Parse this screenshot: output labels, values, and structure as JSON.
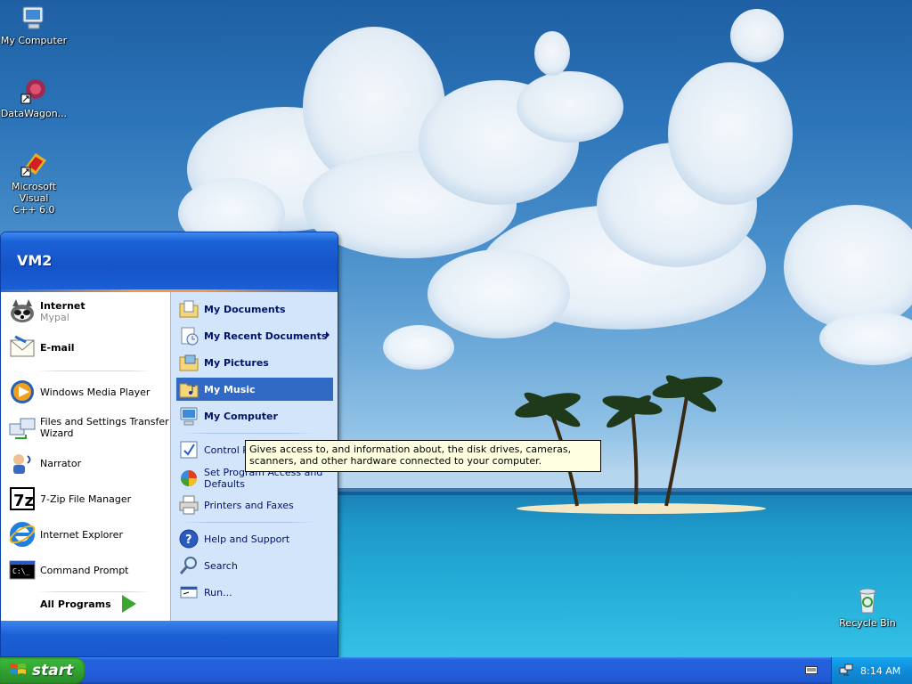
{
  "desktop": {
    "icons": [
      {
        "label": "My Computer",
        "icon": "my-computer-icon"
      },
      {
        "label": "DataWagon...",
        "icon": "datawagon-shortcut-icon"
      },
      {
        "label": "Microsoft Visual\nC++ 6.0",
        "icon": "visual-cpp-shortcut-icon"
      },
      {
        "label": "Recycle Bin",
        "icon": "recycle-bin-icon"
      }
    ]
  },
  "start_menu": {
    "user_name": "VM2",
    "pinned": [
      {
        "label": "Internet",
        "sub": "Mypal",
        "icon": "mypal-browser-icon"
      },
      {
        "label": "E-mail",
        "icon": "email-icon"
      }
    ],
    "recent": [
      {
        "label": "Windows Media Player",
        "icon": "windows-media-player-icon"
      },
      {
        "label": "Files and Settings Transfer\nWizard",
        "icon": "files-settings-transfer-icon"
      },
      {
        "label": "Narrator",
        "icon": "narrator-icon"
      },
      {
        "label": "7-Zip File Manager",
        "icon": "seven-zip-icon"
      },
      {
        "label": "Internet Explorer",
        "icon": "internet-explorer-icon"
      },
      {
        "label": "Command Prompt",
        "icon": "command-prompt-icon"
      }
    ],
    "all_programs": "All Programs",
    "places": [
      {
        "label": "My Documents",
        "icon": "my-documents-icon"
      },
      {
        "label": "My Recent Documents",
        "icon": "my-recent-documents-icon"
      },
      {
        "label": "My Pictures",
        "icon": "my-pictures-icon"
      },
      {
        "label": "My Music",
        "icon": "my-music-icon",
        "selected": true
      },
      {
        "label": "My Computer",
        "icon": "my-computer-icon"
      }
    ],
    "settings": [
      {
        "label": "Control Panel",
        "icon": "control-panel-icon"
      },
      {
        "label": "Set Program Access and\nDefaults",
        "icon": "set-program-access-icon"
      },
      {
        "label": "Printers and Faxes",
        "icon": "printers-faxes-icon"
      }
    ],
    "help": [
      {
        "label": "Help and Support",
        "icon": "help-icon"
      },
      {
        "label": "Search",
        "icon": "search-icon"
      },
      {
        "label": "Run...",
        "icon": "run-icon"
      }
    ]
  },
  "tooltip": "Gives access to, and information about, the disk drives, cameras, scanners, and other hardware connected to your computer.",
  "taskbar": {
    "start_label": "start",
    "clock": "8:14 AM"
  },
  "colors": {
    "selection": "#316ac5",
    "taskbar": "#245edb",
    "start_green": "#39b539",
    "tray": "#0f8bd8"
  }
}
